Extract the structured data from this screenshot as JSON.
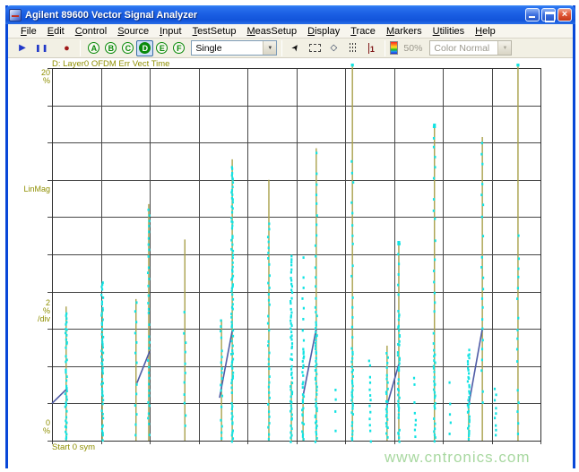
{
  "window": {
    "title": "Agilent 89600 Vector Signal Analyzer",
    "controls": {
      "minimize": "minimize",
      "maximize": "maximize",
      "close": "close"
    }
  },
  "menu": {
    "items": [
      "File",
      "Edit",
      "Control",
      "Source",
      "Input",
      "TestSetup",
      "MeasSetup",
      "Display",
      "Trace",
      "Markers",
      "Utilities",
      "Help"
    ]
  },
  "toolbar": {
    "trace_buttons": [
      "A",
      "B",
      "C",
      "D",
      "E",
      "F"
    ],
    "active_trace": "D",
    "sweep_mode": "Single",
    "zoom_level": "50%",
    "color_mode": "Color Normal"
  },
  "icons": {
    "play": "▶",
    "pause": "❚❚",
    "record": "●",
    "pointer": "➤",
    "diamond": "◇",
    "marker_number": "1",
    "combo_arrow": "▼",
    "close_glyph": "×"
  },
  "trace": {
    "title": "D: Layer0 OFDM Err Vect Time",
    "y_max": "20",
    "y_max_unit": "%",
    "y_axis_label": "LinMag",
    "per_div_value": "2",
    "per_div_unit": "%",
    "per_div_suffix": "/div",
    "y_min": "0",
    "y_min_unit": "%",
    "x_start_label": "Start 0 sym"
  },
  "watermark": "www.cntronics.com",
  "chart_data": {
    "type": "scatter",
    "title": "D: Layer0 OFDM Err Vect Time",
    "ylabel": "LinMag (%)",
    "xlabel": "sym",
    "ylim": [
      0,
      20
    ],
    "y_per_div": 2,
    "x_start_sym": 0,
    "grid": {
      "cols": 10,
      "rows": 10,
      "on": true
    },
    "colors": {
      "spike": "#a9a14b",
      "dots": "#12e2e2",
      "ramp": "#4f5ba6",
      "grid": "#474747",
      "frame": "#2f2f2f",
      "label": "#8f8f00"
    },
    "columns": [
      {
        "sym": 0,
        "x_frac": 0.029,
        "spike": 7.2,
        "dots": [
          [
            7.2,
            0,
            "dense"
          ]
        ]
      },
      {
        "sym": 1,
        "x_frac": 0.103,
        "spike": 7.0,
        "dots": [
          [
            8.6,
            0,
            "dense"
          ]
        ]
      },
      {
        "sym": 2,
        "x_frac": 0.172,
        "spike": 7.6,
        "dots": [
          [
            7.5,
            0,
            "sparse"
          ]
        ]
      },
      {
        "sym": 3,
        "x_frac": 0.198,
        "spike": 12.7,
        "dots": [
          [
            12.5,
            0,
            "medium"
          ]
        ]
      },
      {
        "sym": 4,
        "x_frac": 0.272,
        "spike": 10.8,
        "dots": [
          [
            7.0,
            0,
            "sparse"
          ]
        ]
      },
      {
        "sym": 5,
        "x_frac": 0.347,
        "spike": 6.5,
        "dots": [
          [
            6.5,
            0,
            "medium"
          ]
        ]
      },
      {
        "sym": 6,
        "x_frac": 0.369,
        "spike": 15.1,
        "dots": [
          [
            14.8,
            0,
            "dense"
          ]
        ]
      },
      {
        "sym": 7,
        "x_frac": 0.444,
        "spike": 14.0,
        "dots": [
          [
            12.0,
            0,
            "medium"
          ]
        ]
      },
      {
        "sym": 8,
        "x_frac": 0.49,
        "spike": 3.2,
        "dots": [
          [
            9.9,
            0,
            "dense"
          ]
        ]
      },
      {
        "sym": 9,
        "x_frac": 0.514,
        "spike": 2.4,
        "dots": [
          [
            9.9,
            4.9,
            "sparse"
          ],
          [
            4.9,
            0,
            "dense"
          ]
        ]
      },
      {
        "sym": 10,
        "x_frac": 0.541,
        "spike": 15.7,
        "dots": [
          [
            15.5,
            7.0,
            "sparse"
          ],
          [
            7.0,
            0,
            "dense"
          ]
        ]
      },
      {
        "sym": 11,
        "x_frac": 0.582,
        "spike": 0,
        "dots": [
          [
            2.8,
            0,
            "sparse"
          ]
        ]
      },
      {
        "sym": 12,
        "x_frac": 0.615,
        "spike": 20.2,
        "top_dot": true,
        "dots": [
          [
            15.0,
            5.0,
            "sparse"
          ],
          [
            5.0,
            0,
            "dense"
          ]
        ]
      },
      {
        "sym": 13,
        "x_frac": 0.651,
        "spike": 0,
        "dots": [
          [
            4.4,
            0,
            "medium"
          ]
        ]
      },
      {
        "sym": 14,
        "x_frac": 0.686,
        "spike": 5.1,
        "dots": [
          [
            4.7,
            0,
            "dense"
          ]
        ]
      },
      {
        "sym": 15,
        "x_frac": 0.71,
        "spike": 10.6,
        "top_dot": true,
        "dots": [
          [
            10.6,
            7.0,
            "sparse"
          ],
          [
            7.0,
            0,
            "dense"
          ]
        ]
      },
      {
        "sym": 16,
        "x_frac": 0.743,
        "spike": 0,
        "dots": [
          [
            3.7,
            0,
            "medium"
          ]
        ]
      },
      {
        "sym": 17,
        "x_frac": 0.783,
        "spike": 16.9,
        "top_dot": true,
        "dots": [
          [
            16.9,
            5.0,
            "sparse"
          ],
          [
            5.0,
            0,
            "dense"
          ]
        ]
      },
      {
        "sym": 18,
        "x_frac": 0.815,
        "spike": 0,
        "dots": [
          [
            3.2,
            0,
            "sparse"
          ]
        ]
      },
      {
        "sym": 19,
        "x_frac": 0.853,
        "spike": 2.0,
        "dots": [
          [
            4.9,
            0,
            "dense"
          ]
        ]
      },
      {
        "sym": 20,
        "x_frac": 0.881,
        "spike": 16.3,
        "dots": [
          [
            16.0,
            2.0,
            "sparse"
          ]
        ]
      },
      {
        "sym": 21,
        "x_frac": 0.908,
        "spike": 0,
        "dots": [
          [
            2.8,
            0,
            "medium"
          ]
        ]
      },
      {
        "sym": 22,
        "x_frac": 0.954,
        "spike": 20.2,
        "top_dot": true,
        "dots": [
          [
            11.0,
            0,
            "sparse"
          ]
        ]
      }
    ],
    "ramps": [
      {
        "x1": 0.0,
        "y1": 2.0,
        "x2": 0.031,
        "y2": 2.8
      },
      {
        "x1": 0.174,
        "y1": 3.1,
        "x2": 0.2,
        "y2": 4.8
      },
      {
        "x1": 0.343,
        "y1": 2.3,
        "x2": 0.369,
        "y2": 5.9
      },
      {
        "x1": 0.514,
        "y1": 2.4,
        "x2": 0.541,
        "y2": 6.0
      },
      {
        "x1": 0.686,
        "y1": 1.9,
        "x2": 0.71,
        "y2": 4.1
      },
      {
        "x1": 0.853,
        "y1": 1.9,
        "x2": 0.881,
        "y2": 6.0
      }
    ]
  }
}
